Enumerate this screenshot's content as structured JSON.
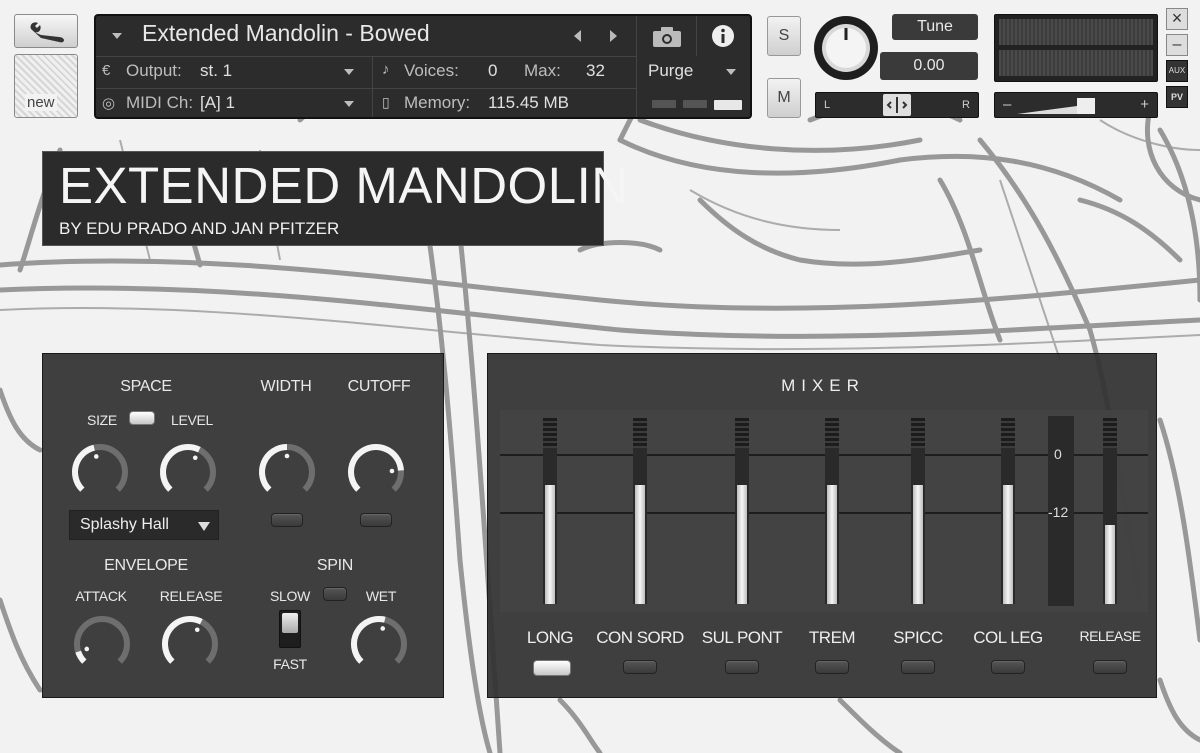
{
  "header": {
    "instrument_name": "Extended Mandolin - Bowed",
    "output_label": "Output:",
    "output_value": "st. 1",
    "midi_label": "MIDI Ch:",
    "midi_value": "[A]  1",
    "voices_label": "Voices:",
    "voices_value": "0",
    "max_label": "Max:",
    "max_value": "32",
    "memory_label": "Memory:",
    "memory_value": "115.45 MB",
    "purge_label": "Purge",
    "solo_label": "S",
    "mute_label": "M",
    "tune_label": "Tune",
    "tune_value": "0.00",
    "pan_left": "L",
    "pan_right": "R",
    "vol_minus": "–",
    "vol_plus": "+",
    "aux_label": "AUX",
    "pv_label": "PV",
    "close_label": "×",
    "minimize_label": "–",
    "new_label": "new"
  },
  "title": {
    "main": "EXTENDED MANDOLIN",
    "subtitle": "BY EDU PRADO AND JAN PFITZER"
  },
  "effects": {
    "space_label": "SPACE",
    "size_label": "SIZE",
    "level_label": "LEVEL",
    "width_label": "WIDTH",
    "cutoff_label": "CUTOFF",
    "reverb_type": "Splashy Hall",
    "envelope_label": "ENVELOPE",
    "attack_label": "ATTACK",
    "release_label": "RELEASE",
    "spin_label": "SPIN",
    "slow_label": "SLOW",
    "fast_label": "FAST",
    "wet_label": "WET",
    "knobs": {
      "size": 0.45,
      "level": 0.6,
      "width": 0.5,
      "cutoff": 0.82,
      "attack": 0.1,
      "release": 0.6,
      "wet": 0.55
    }
  },
  "mixer": {
    "title": "MIXER",
    "channels": [
      {
        "label": "LONG",
        "level": 0.78,
        "active": true
      },
      {
        "label": "CON SORD",
        "level": 0.78,
        "active": false
      },
      {
        "label": "SUL PONT",
        "level": 0.78,
        "active": false
      },
      {
        "label": "TREM",
        "level": 0.78,
        "active": false
      },
      {
        "label": "SPICC",
        "level": 0.78,
        "active": false
      },
      {
        "label": "COL LEG",
        "level": 0.78,
        "active": false
      }
    ],
    "meter_scale_0": "0",
    "meter_scale_12": "-12",
    "release": {
      "label": "RELEASE",
      "level": 0.52,
      "active": false
    }
  },
  "colors": {
    "panel_bg": "#323232",
    "accent_white": "#f5f5f5",
    "header_bg": "#2c2c2c"
  },
  "icons": {
    "wrench": "wrench-icon",
    "camera": "camera-icon",
    "info": "info-icon"
  }
}
